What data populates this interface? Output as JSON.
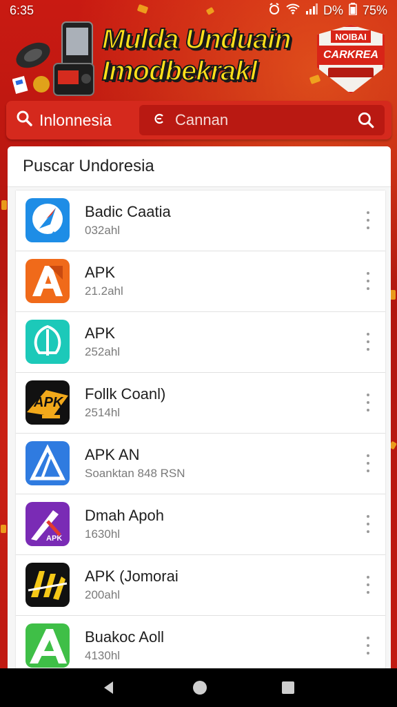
{
  "status_bar": {
    "time": "6:35",
    "battery_label": "75%",
    "icons": [
      "alarm-icon",
      "wifi-icon",
      "signal-icon",
      "data-icon",
      "battery-icon"
    ],
    "data_label": "D%"
  },
  "banner": {
    "title_line1": "Mulda Unduain",
    "title_line2": "Imodbekrakl",
    "badge_top": "NOIBAI",
    "badge_main": "CARKREA"
  },
  "search_bar": {
    "region_label": "Inlonnesia",
    "query": "Cannan"
  },
  "list_header": "Puscar Undoresia",
  "apps": [
    {
      "name": "Badic Caatia",
      "size": "032ahl",
      "icon": "apk-compass-icon",
      "color": "#1e8de6"
    },
    {
      "name": "APK",
      "size": "21.2ahl",
      "icon": "apk-a-orange-icon",
      "color": "#f06a1a"
    },
    {
      "name": "APK",
      "size": "252ahl",
      "icon": "apk-leaf-teal-icon",
      "color": "#1cc9b9"
    },
    {
      "name": "Follk Coanl)",
      "size": "2514hl",
      "icon": "apk-black-gold-icon",
      "color": "#111111"
    },
    {
      "name": "APK AN",
      "size": "Soanktan 848 RSN",
      "icon": "apk-triangle-blue-icon",
      "color": "#2f7be0"
    },
    {
      "name": "Dmah Apoh",
      "size": "1630hl",
      "icon": "apk-purple-icon",
      "color": "#7a2bb5"
    },
    {
      "name": "APK (Jomorai",
      "size": "200ahl",
      "icon": "apk-graffiti-icon",
      "color": "#111111"
    },
    {
      "name": "Buakoc Aoll",
      "size": "4130hl",
      "icon": "apk-a-green-icon",
      "color": "#3fbf47"
    }
  ],
  "nav_bar": {
    "icons": [
      "back-icon",
      "home-icon",
      "recents-icon"
    ]
  }
}
